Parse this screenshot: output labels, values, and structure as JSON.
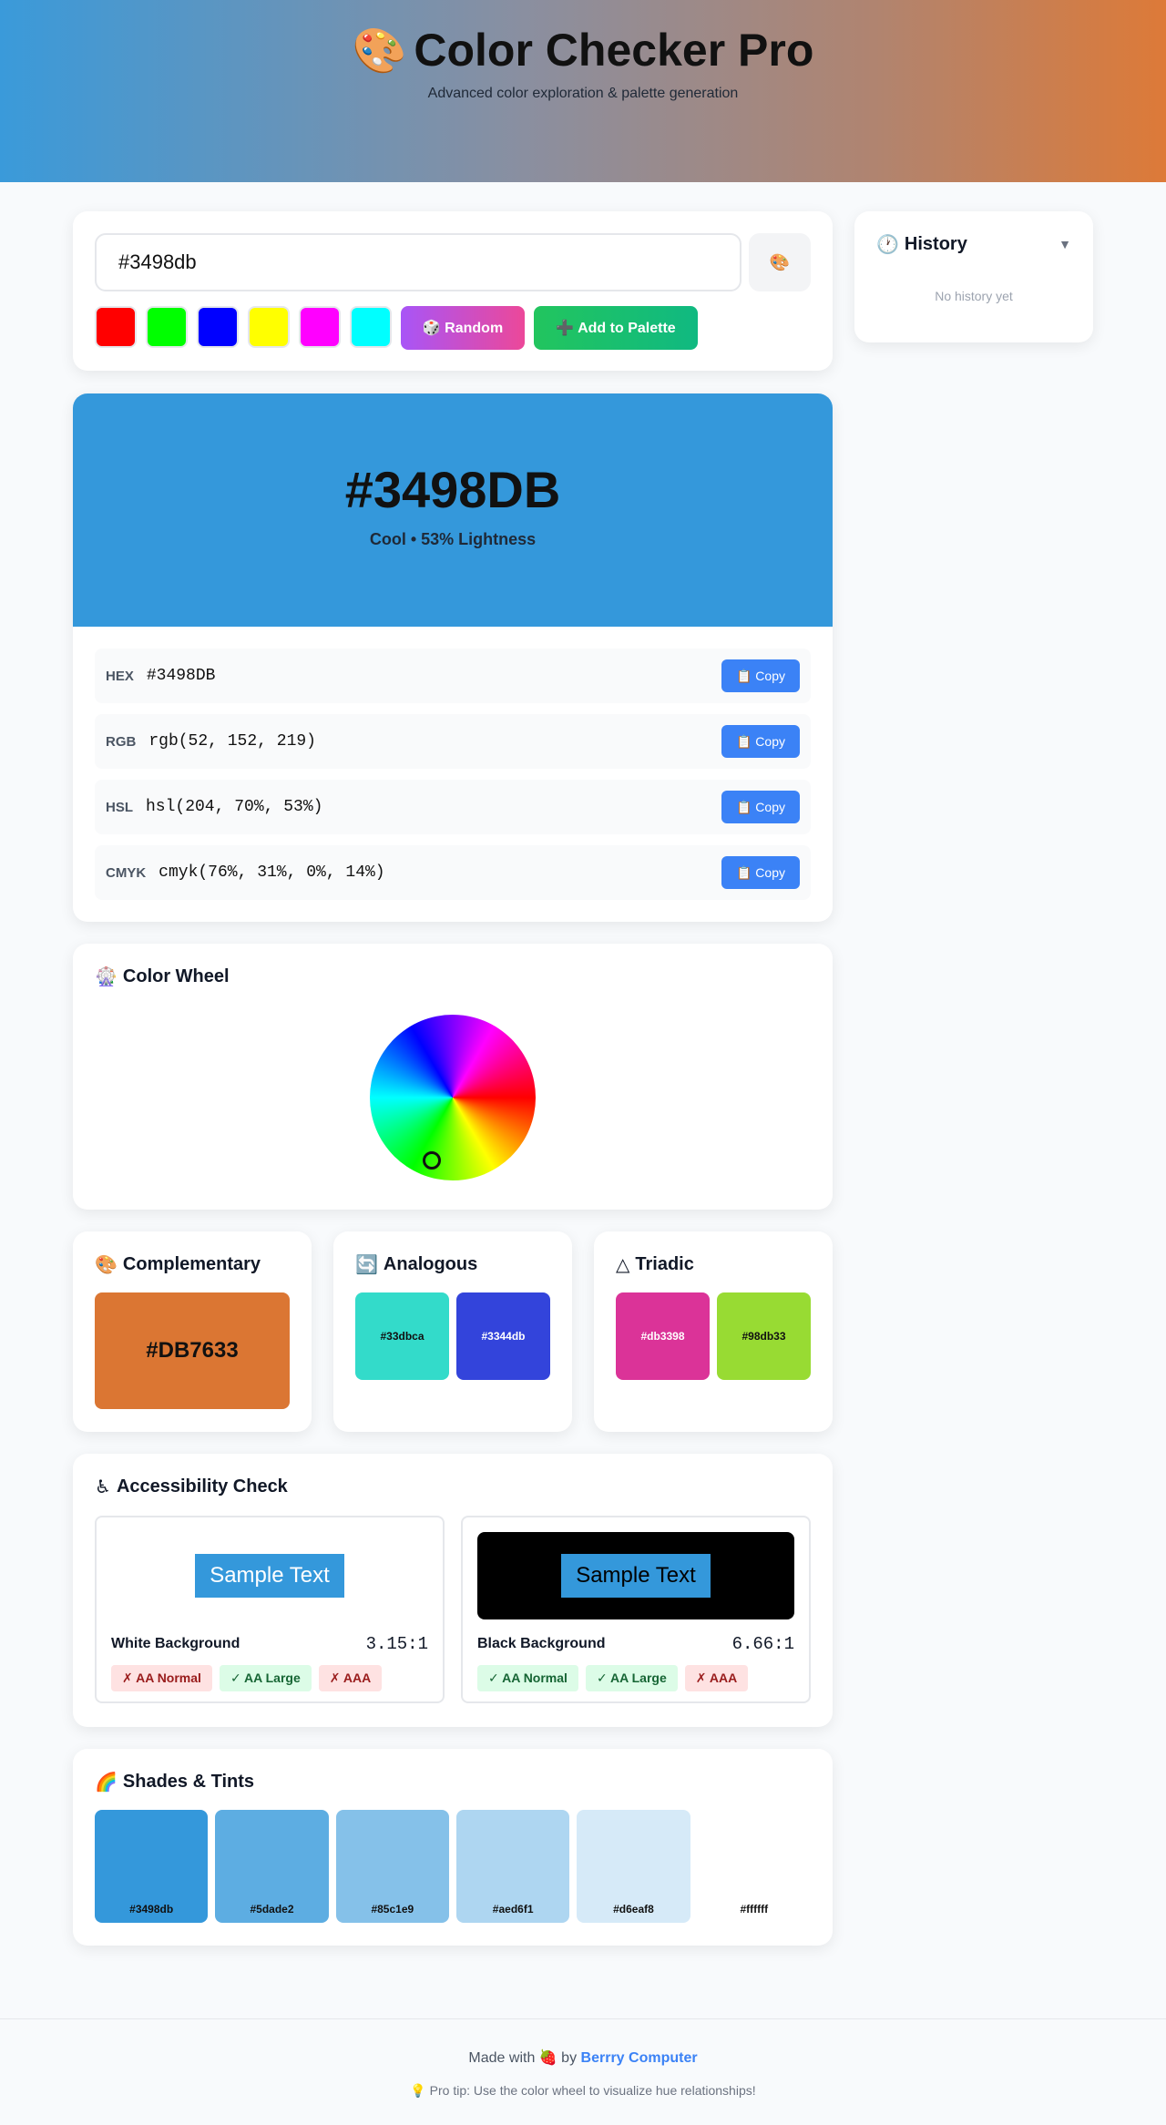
{
  "header": {
    "logo": "🎨",
    "title": "Color Checker Pro",
    "subtitle": "Advanced color exploration & palette generation"
  },
  "input": {
    "value": "#3498db",
    "picker_icon": "🎨",
    "presets": [
      "#ff0000",
      "#00ff00",
      "#0000ff",
      "#ffff00",
      "#ff00ff",
      "#00ffff"
    ],
    "random_label": "🎲 Random",
    "add_label": "➕ Add to Palette"
  },
  "history": {
    "icon": "🕐",
    "title": "History",
    "toggle": "▼",
    "empty": "No history yet"
  },
  "preview": {
    "color": "#3498db",
    "hex": "#3498DB",
    "description": "Cool • 53% Lightness",
    "formats": [
      {
        "label": "HEX",
        "value": "#3498DB",
        "copy": "📋 Copy"
      },
      {
        "label": "RGB",
        "value": "rgb(52, 152, 219)",
        "copy": "📋 Copy"
      },
      {
        "label": "HSL",
        "value": "hsl(204, 70%, 53%)",
        "copy": "📋 Copy"
      },
      {
        "label": "CMYK",
        "value": "cmyk(76%, 31%, 0%, 14%)",
        "copy": "📋 Copy"
      }
    ]
  },
  "wheel": {
    "icon": "🎡",
    "title": "Color Wheel"
  },
  "harmony": {
    "complementary": {
      "icon": "🎨",
      "title": "Complementary",
      "color": "#db7633",
      "label": "#DB7633"
    },
    "analogous": {
      "icon": "🔄",
      "title": "Analogous",
      "colors": [
        {
          "color": "#33dbca",
          "label": "#33dbca",
          "text": "#111111"
        },
        {
          "color": "#3344db",
          "label": "#3344db",
          "text": "#ffffff"
        }
      ]
    },
    "triadic": {
      "icon": "△",
      "title": "Triadic",
      "colors": [
        {
          "color": "#db3398",
          "label": "#db3398",
          "text": "#ffffff"
        },
        {
          "color": "#98db33",
          "label": "#98db33",
          "text": "#111111"
        }
      ]
    }
  },
  "accessibility": {
    "icon": "♿",
    "title": "Accessibility Check",
    "sample": "Sample Text",
    "white": {
      "label": "White Background",
      "ratio": "3.15:1",
      "badges": [
        {
          "text": "✗ AA Normal",
          "pass": false
        },
        {
          "text": "✓ AA Large",
          "pass": true
        },
        {
          "text": "✗ AAA",
          "pass": false
        }
      ]
    },
    "black": {
      "label": "Black Background",
      "ratio": "6.66:1",
      "badges": [
        {
          "text": "✓ AA Normal",
          "pass": true
        },
        {
          "text": "✓ AA Large",
          "pass": true
        },
        {
          "text": "✗ AAA",
          "pass": false
        }
      ]
    }
  },
  "shades": {
    "icon": "🌈",
    "title": "Shades & Tints",
    "items": [
      "#3498db",
      "#5dade2",
      "#85c1e9",
      "#aed6f1",
      "#d6eaf8",
      "#ffffff"
    ]
  },
  "footer": {
    "made_with": "Made with",
    "heart": "🍓",
    "by": "by",
    "brand": "Berrry Computer",
    "tip": "💡 Pro tip: Use the color wheel to visualize hue relationships!"
  }
}
